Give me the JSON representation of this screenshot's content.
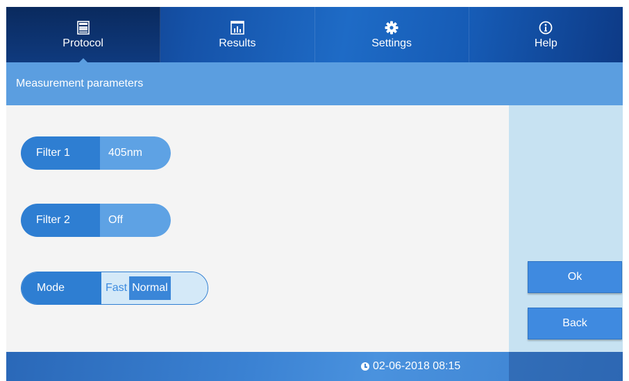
{
  "nav": {
    "tabs": [
      {
        "label": "Protocol",
        "icon": "protocol-icon",
        "active": true
      },
      {
        "label": "Results",
        "icon": "results-chart-icon",
        "active": false
      },
      {
        "label": "Settings",
        "icon": "gear-icon",
        "active": false
      },
      {
        "label": "Help",
        "icon": "info-icon",
        "active": false
      }
    ]
  },
  "section": {
    "title": "Measurement parameters"
  },
  "params": {
    "filter1": {
      "label": "Filter 1",
      "value": "405nm"
    },
    "filter2": {
      "label": "Filter 2",
      "value": "Off"
    },
    "mode": {
      "label": "Mode",
      "options": [
        "Fast",
        "Normal"
      ],
      "selected": "Normal"
    }
  },
  "actions": {
    "ok": "Ok",
    "back": "Back"
  },
  "footer": {
    "datetime": "02-06-2018 08:15"
  },
  "colors": {
    "accent": "#2e7ed2",
    "header": "#5b9ee0",
    "sidebar": "#c7e2f2"
  }
}
